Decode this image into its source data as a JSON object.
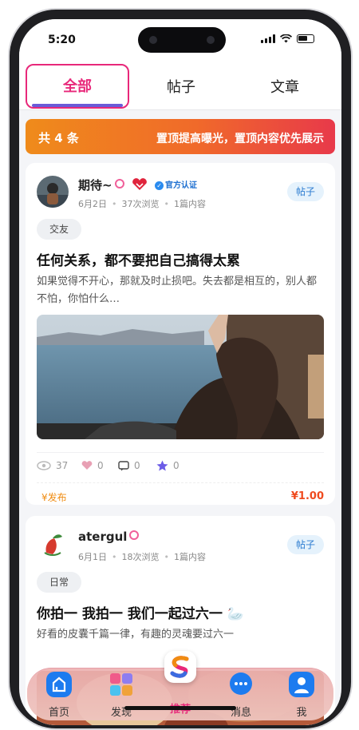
{
  "status_bar": {
    "time": "5:20"
  },
  "tabs": [
    {
      "label": "全部",
      "active": true
    },
    {
      "label": "帖子",
      "active": false
    },
    {
      "label": "文章",
      "active": false
    }
  ],
  "banner": {
    "count": "共 4 条",
    "promo": "置顶提高曝光，置顶内容优先展示"
  },
  "posts": [
    {
      "author": "期待~",
      "verified": "官方认证",
      "date": "6月2日",
      "views": "37次浏览",
      "items": "1篇内容",
      "type": "帖子",
      "category": "交友",
      "title": "任何关系，都不要把自己搞得太累",
      "body": "如果觉得不开心，那就及时止损吧。失去都是相互的，别人都不怕，你怕什么…",
      "stats": {
        "views": "37",
        "likes": "0",
        "comments": "0",
        "stars": "0"
      },
      "publish": "¥发布",
      "price": "¥1.00"
    },
    {
      "author": "atergul",
      "date": "6月1日",
      "views": "18次浏览",
      "items": "1篇内容",
      "type": "帖子",
      "category": "日常",
      "title": "你拍一 我拍一 我们一起过六一 🦢",
      "body": "好看的皮囊千篇一律，有趣的灵魂要过六一"
    }
  ],
  "navbar": [
    {
      "label": "首页",
      "icon": "home-icon"
    },
    {
      "label": "发现",
      "icon": "discover-icon"
    },
    {
      "label": "推荐",
      "icon": "recommend-icon"
    },
    {
      "label": "消息",
      "icon": "message-icon"
    },
    {
      "label": "我",
      "icon": "profile-icon"
    }
  ],
  "colors": {
    "accent": "#e8287a",
    "price": "#ef4a1e",
    "banner_start": "#ef8b1b",
    "banner_end": "#e8394a"
  }
}
